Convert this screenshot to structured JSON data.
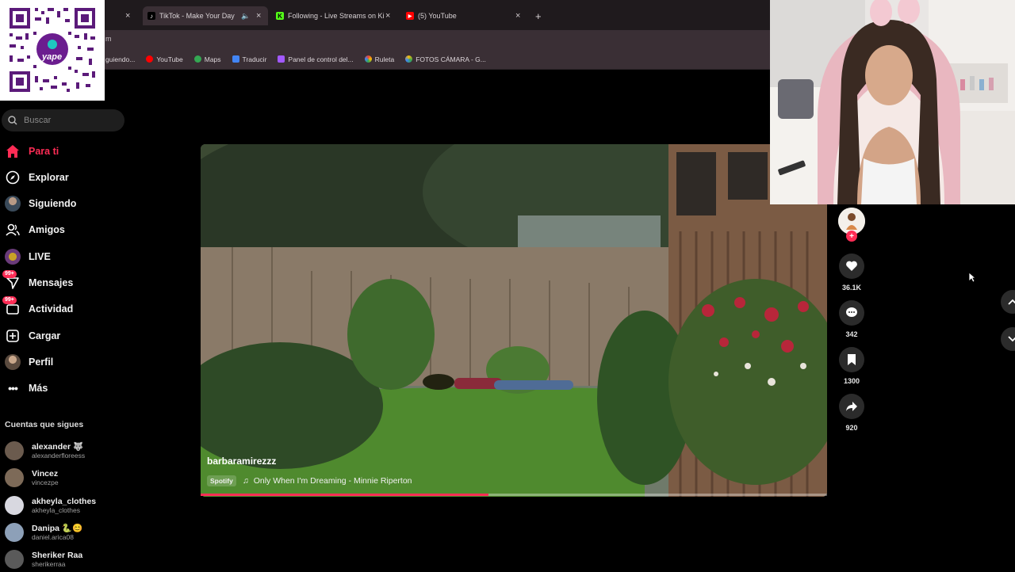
{
  "browser": {
    "tabs": [
      {
        "label": "TikTok - Make Your Day",
        "icon": "tiktok-icon"
      },
      {
        "label": "Following - Live Streams on Ki",
        "icon": "kick-icon"
      },
      {
        "label": "(5) YouTube",
        "icon": "youtube-icon"
      }
    ],
    "new_tab": "+",
    "url_fragment": "m",
    "bookmarks": [
      {
        "label": "guiendo...",
        "color": "#8a8a8a"
      },
      {
        "label": "YouTube",
        "color": "#ff0000"
      },
      {
        "label": "Maps",
        "color": "#34a853"
      },
      {
        "label": "Traducir",
        "color": "#4285f4"
      },
      {
        "label": "Panel de control del...",
        "color": "#a259ff"
      },
      {
        "label": "Ruleta",
        "color": "#fbbc05"
      },
      {
        "label": "FOTOS CÁMARA - G...",
        "color": "#34a853"
      }
    ]
  },
  "qr": {
    "brand": "yape"
  },
  "sidebar": {
    "search_placeholder": "Buscar",
    "nav": [
      {
        "label": "Para ti",
        "icon": "home-icon",
        "active": true
      },
      {
        "label": "Explorar",
        "icon": "compass-icon"
      },
      {
        "label": "Siguiendo",
        "icon": "following-avatar-icon"
      },
      {
        "label": "Amigos",
        "icon": "friends-icon"
      },
      {
        "label": "LIVE",
        "icon": "live-icon"
      },
      {
        "label": "Mensajes",
        "icon": "messages-icon",
        "badge": "99+"
      },
      {
        "label": "Actividad",
        "icon": "activity-icon",
        "badge": "99+"
      },
      {
        "label": "Cargar",
        "icon": "upload-icon"
      },
      {
        "label": "Perfil",
        "icon": "profile-avatar-icon"
      },
      {
        "label": "Más",
        "icon": "more-icon"
      }
    ],
    "following_title": "Cuentas que sigues",
    "accounts": [
      {
        "name": "alexander 🐺",
        "username": "alexanderfloreess",
        "color": "#6b5b4e"
      },
      {
        "name": "Vincez",
        "username": "vincezpe",
        "color": "#7d6a58"
      },
      {
        "name": "akheyla_clothes",
        "username": "akheyla_clothes",
        "color": "#d8d8e0"
      },
      {
        "name": "Danipa 🐍😊",
        "username": "daniel.arica08",
        "color": "#8da0b8"
      },
      {
        "name": "Sheriker Raa",
        "username": "sherikerraa",
        "color": "#5a5a5a"
      }
    ]
  },
  "video": {
    "author": "barbaramirezzz",
    "music_source": "Spotify",
    "music": "Only When I'm Dreaming - Minnie Riperton",
    "progress": 0.46
  },
  "actions": {
    "likes": "36.1K",
    "comments": "342",
    "saves": "1300",
    "shares": "920"
  },
  "colors": {
    "accent": "#fe2c55",
    "bg": "#000000"
  }
}
